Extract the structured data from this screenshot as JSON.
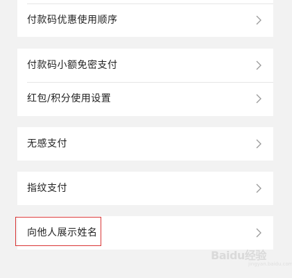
{
  "settings": {
    "items": [
      {
        "label": "付款码优惠使用顺序"
      },
      {
        "label": "付款码小额免密支付"
      },
      {
        "label": "红包/积分使用设置"
      },
      {
        "label": "无感支付"
      },
      {
        "label": "指纹支付"
      },
      {
        "label": "向他人展示姓名"
      }
    ]
  },
  "watermark": {
    "brand": "Baidu经验",
    "url": "jingyan.baidu.com"
  },
  "colors": {
    "page_background": "#f2f2f2",
    "card_background": "#ffffff",
    "highlight": "#d93434",
    "chevron": "#999999"
  },
  "icons": {
    "chevron": "chevron-right-icon"
  }
}
